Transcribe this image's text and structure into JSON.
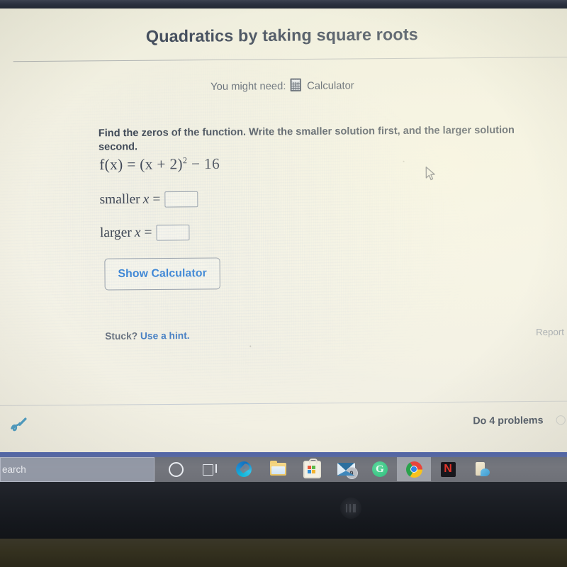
{
  "exercise": {
    "title": "Quadratics by taking square roots",
    "need_label": "You might need:",
    "calculator_label": "Calculator",
    "calculator_icon": "calculator-icon",
    "prompt": "Find the zeros of the function. Write the smaller solution first, and the larger solution second.",
    "equation": {
      "lhs": "f(x) =",
      "rhs": "(x + 2)",
      "exponent": "2",
      "tail": "− 16",
      "plain": "f(x) = (x + 2)² − 16"
    },
    "answers": [
      {
        "label": "smaller",
        "var": "x",
        "equals": "=",
        "value": "",
        "placeholder": ""
      },
      {
        "label": "larger",
        "var": "x",
        "equals": "=",
        "value": "",
        "placeholder": ""
      }
    ],
    "show_calculator_button": "Show Calculator",
    "stuck_label": "Stuck?",
    "hint_link": "Use a hint.",
    "report_link": "Report a",
    "footer_progress": "Do 4 problems",
    "doodle_icon": "scribble-check-icon"
  },
  "colors": {
    "title": "#454f5e",
    "link_blue": "#3b86d6",
    "hint_blue": "#4a82c4",
    "screen_bg": "#f2f0e2",
    "taskbar": "#74767d",
    "accent_blue": "#4f63a6"
  },
  "taskbar": {
    "search_placeholder": "earch",
    "items": [
      {
        "name": "cortana-icon",
        "label": "Cortana",
        "active": false,
        "badge": ""
      },
      {
        "name": "task-view-icon",
        "label": "Task View",
        "active": false,
        "badge": ""
      },
      {
        "name": "edge-icon",
        "label": "Microsoft Edge",
        "active": false,
        "badge": ""
      },
      {
        "name": "file-explorer-icon",
        "label": "File Explorer",
        "active": false,
        "badge": ""
      },
      {
        "name": "microsoft-store-icon",
        "label": "Microsoft Store",
        "active": false,
        "badge": ""
      },
      {
        "name": "mail-icon",
        "label": "Mail",
        "active": false,
        "badge": "9"
      },
      {
        "name": "grammarly-icon",
        "label": "Grammarly",
        "active": false,
        "badge": ""
      },
      {
        "name": "chrome-icon",
        "label": "Google Chrome",
        "active": true,
        "badge": ""
      },
      {
        "name": "netflix-icon",
        "label": "Netflix",
        "active": false,
        "badge": ""
      },
      {
        "name": "onenote-icon",
        "label": "OneNote",
        "active": false,
        "badge": ""
      }
    ]
  },
  "device": {
    "brand_logo": "hp-logo"
  }
}
